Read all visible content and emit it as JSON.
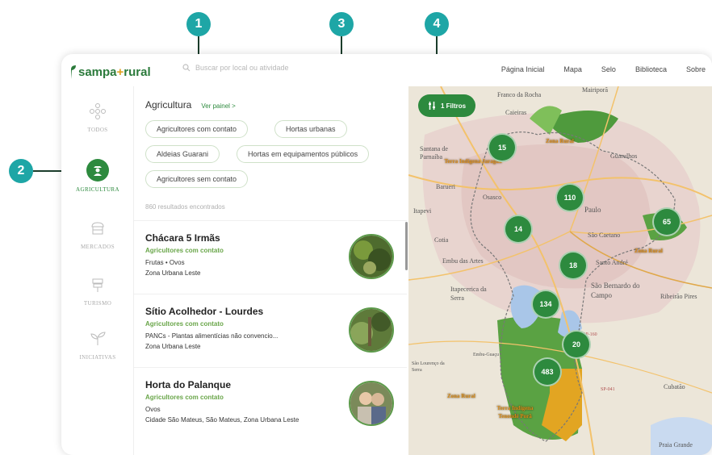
{
  "callouts": [
    "1",
    "2",
    "3",
    "4"
  ],
  "logo": {
    "text_a": "sampa",
    "text_plus": "+",
    "text_b": "rural"
  },
  "search": {
    "placeholder": "Buscar por local ou atividade"
  },
  "nav": [
    "Página Inicial",
    "Mapa",
    "Selo",
    "Biblioteca",
    "Sobre"
  ],
  "sidebar": [
    {
      "label": "TODOS",
      "icon": "dots-icon"
    },
    {
      "label": "AGRICULTURA",
      "icon": "farmer-icon",
      "active": true
    },
    {
      "label": "MERCADOS",
      "icon": "market-icon"
    },
    {
      "label": "TURISMO",
      "icon": "sign-icon"
    },
    {
      "label": "INICIATIVAS",
      "icon": "sprout-icon"
    }
  ],
  "panel": {
    "title": "Agricultura",
    "link": "Ver painel >",
    "chips": [
      "Agricultores com contato",
      "Hortas urbanas",
      "Aldeias Guarani",
      "Hortas em equipamentos públicos",
      "Agricultores sem contato"
    ],
    "results": "860 resultados encontrados"
  },
  "cards": [
    {
      "name": "Chácara 5 Irmãs",
      "tag": "Agricultores com contato",
      "line1": "Frutas • Ovos",
      "line2": "Zona Urbana Leste"
    },
    {
      "name": "Sítio Acolhedor - Lourdes",
      "tag": "Agricultores com contato",
      "line1": "PANCs - Plantas alimentícias não convencio...",
      "line2": "Zona Urbana Leste"
    },
    {
      "name": "Horta do Palanque",
      "tag": "Agricultores com contato",
      "line1": "Ovos",
      "line2": "Cidade São Mateus, São Mateus, Zona Urbana Leste"
    }
  ],
  "map": {
    "filters_label": "1 Filtros",
    "clusters": [
      "15",
      "110",
      "65",
      "14",
      "18",
      "134",
      "20",
      "483"
    ],
    "labels": [
      "Franco da Rocha",
      "Mairiporã",
      "Caieiras",
      "Santana de Parnaíba",
      "Guarulhos",
      "Barueri",
      "Osasco",
      "Itapevi",
      "Cotia",
      "São Caetano",
      "Santo André",
      "Embu das Artes",
      "Itapecerica da Serra",
      "São Bernardo do Campo",
      "Ribeirão Pires",
      "Embu-Guaçu",
      "São Lourenço da Serra",
      "Cubatão",
      "Praia Grande",
      "SP-160",
      "SP-041",
      "Paulo"
    ],
    "zones": [
      "Zona Rural",
      "Terra Indígena Jaraguá",
      "Zona Rural",
      "Zona Rural",
      "Terra Indígena Tenondé Porã"
    ],
    "colors": {
      "green": "#2d8a3e",
      "orange": "#e0a21f",
      "accent": "#1ea6a6"
    }
  }
}
